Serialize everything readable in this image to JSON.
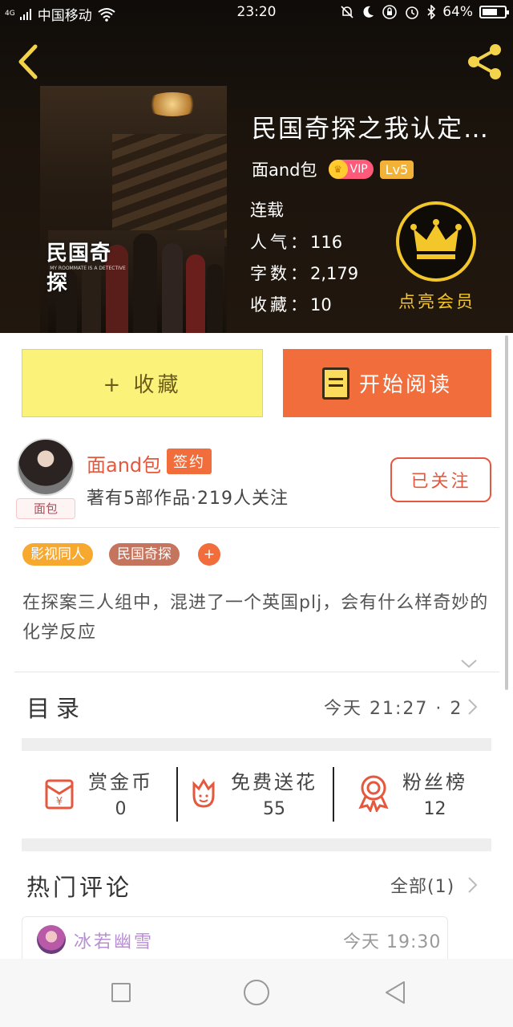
{
  "status_bar": {
    "signal": "4G",
    "carrier": "中国移动",
    "time": "23:20",
    "battery": "64%"
  },
  "book": {
    "title": "民国奇探之我认定…",
    "cover_title": "民国奇探",
    "cover_subtitle": "MY ROOMMATE IS A DETECTIVE",
    "author": "面and包",
    "vip_label": "VIP",
    "level": "Lv5",
    "status": "连载",
    "popularity_label": "人气：",
    "popularity": "116",
    "wordcount_label": "字数：",
    "wordcount": "2,179",
    "favorites_label": "收藏：",
    "favorites": "10"
  },
  "membership": {
    "label": "点亮会员",
    "color": "#f3c72a"
  },
  "actions": {
    "favorite": "+ 收藏",
    "read": "开始阅读"
  },
  "author_card": {
    "name": "面and包",
    "signed": "签约",
    "avatar_tag": "面包",
    "works": "著有5部作品·219人关注",
    "follow": "已关注"
  },
  "tags": [
    "影视同人",
    "民国奇探",
    "+"
  ],
  "description": "在探案三人组中，混进了一个英国plj，会有什么样奇妙的化学反应",
  "toc": {
    "label": "目录",
    "latest": "今天 21:27 · 2"
  },
  "stats": [
    {
      "icon": "red-envelope-icon",
      "label": "赏金币",
      "value": "0"
    },
    {
      "icon": "flower-icon",
      "label": "免费送花",
      "value": "55"
    },
    {
      "icon": "medal-icon",
      "label": "粉丝榜",
      "value": "12"
    }
  ],
  "comments": {
    "label": "热门评论",
    "all": "全部(1)",
    "items": [
      {
        "user": "冰若幽雪",
        "time": "今天 19:30"
      }
    ]
  },
  "colors": {
    "accent": "#f16d3c",
    "favorite_bg": "#fbf27a",
    "author_red": "#e5583d",
    "tag_orange": "#f7a82f",
    "tag_brown": "#c5745e"
  }
}
